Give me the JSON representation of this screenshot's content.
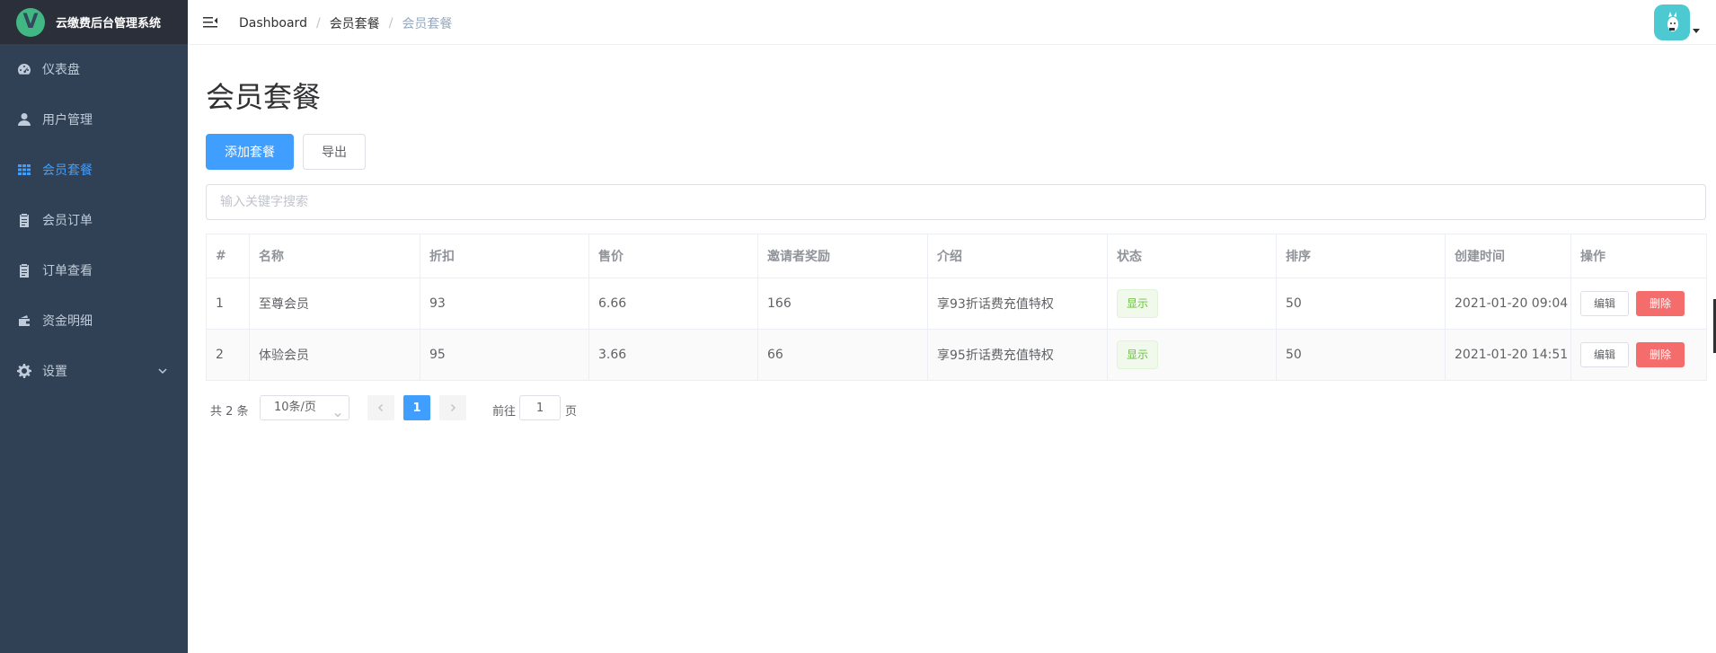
{
  "app": {
    "title": "云缴费后台管理系统",
    "logo_letter": "V"
  },
  "sidebar": {
    "items": [
      {
        "label": "仪表盘",
        "icon": "dashboard-icon",
        "active": false
      },
      {
        "label": "用户管理",
        "icon": "user-icon",
        "active": false
      },
      {
        "label": "会员套餐",
        "icon": "grid-icon",
        "active": true
      },
      {
        "label": "会员订单",
        "icon": "clipboard-icon",
        "active": false
      },
      {
        "label": "订单查看",
        "icon": "clipboard-icon",
        "active": false
      },
      {
        "label": "资金明细",
        "icon": "wallet-icon",
        "active": false
      },
      {
        "label": "设置",
        "icon": "gear-icon",
        "active": false,
        "expandable": true
      }
    ]
  },
  "navbar": {
    "breadcrumb": [
      "Dashboard",
      "会员套餐",
      "会员套餐"
    ]
  },
  "page": {
    "title": "会员套餐",
    "add_button": "添加套餐",
    "export_button": "导出",
    "search_placeholder": "输入关键字搜索"
  },
  "table": {
    "headers": [
      "#",
      "名称",
      "折扣",
      "售价",
      "邀请者奖励",
      "介绍",
      "状态",
      "排序",
      "创建时间",
      "操作"
    ],
    "rows": [
      {
        "id": "1",
        "name": "至尊会员",
        "discount": "93",
        "price": "6.66",
        "reward": "166",
        "intro": "享93折话费充值特权",
        "status": "显示",
        "sort": "50",
        "created": "2021-01-20 09:04",
        "edit": "编辑",
        "delete": "删除"
      },
      {
        "id": "2",
        "name": "体验会员",
        "discount": "95",
        "price": "3.66",
        "reward": "66",
        "intro": "享95折话费充值特权",
        "status": "显示",
        "sort": "50",
        "created": "2021-01-20 14:51",
        "edit": "编辑",
        "delete": "删除"
      }
    ]
  },
  "pagination": {
    "total": "共 2 条",
    "page_size": "10条/页",
    "current_page": "1",
    "goto_prefix": "前往",
    "goto_value": "1",
    "goto_suffix": "页"
  },
  "colors": {
    "sidebar_bg": "#304156",
    "logo_bar_bg": "#2b2f3a",
    "primary": "#409eff",
    "danger": "#f56c6c",
    "success": "#67c23a"
  }
}
